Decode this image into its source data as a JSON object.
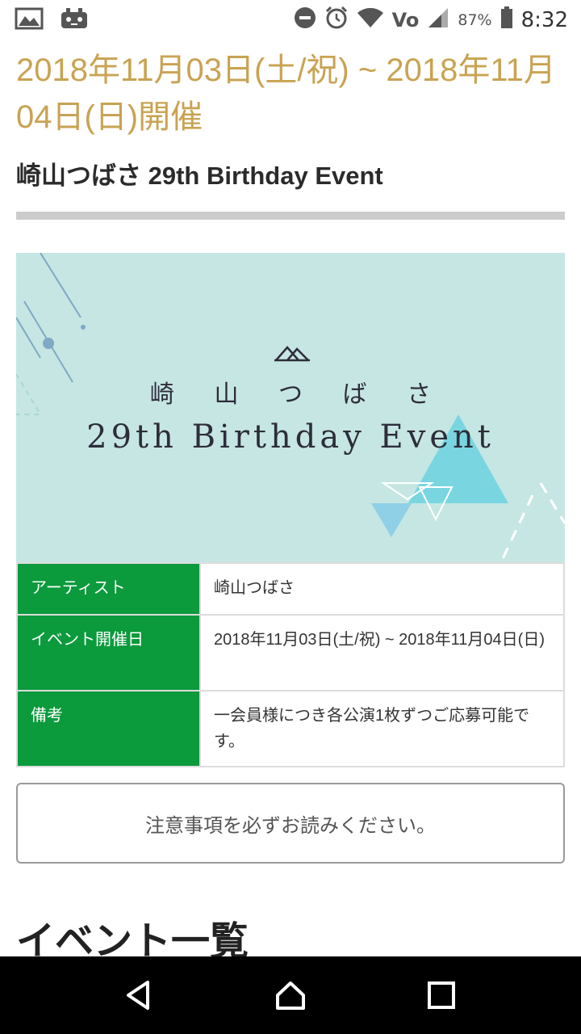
{
  "status_bar": {
    "battery_percent": "87%",
    "time": "8:32",
    "network_label": "Vo",
    "icons": [
      "gallery-icon",
      "game-icon",
      "do-not-disturb-icon",
      "alarm-icon",
      "wifi-icon",
      "volte-icon",
      "signal-icon",
      "battery-icon"
    ]
  },
  "event": {
    "date_heading": "2018年11月03日(土/祝) ~ 2018年11月04日(日)開催",
    "title": "崎山つばさ 29th Birthday Event"
  },
  "banner": {
    "artist_name": "崎 山 つ ば さ",
    "event_name": "29th Birthday Event",
    "background_color": "#c6e6e3",
    "accent_color": "#5fd0e0"
  },
  "info_table": {
    "rows": [
      {
        "key": "アーティスト",
        "value": "崎山つばさ"
      },
      {
        "key": "イベント開催日",
        "value": "2018年11月03日(土/祝) ~ 2018年11月04日(日)"
      },
      {
        "key": "備考",
        "value": "一会員様につき各公演1枚ずつご応募可能です。"
      }
    ],
    "key_color": "#0b9a3c"
  },
  "notice_button": {
    "label": "注意事項を必ずお読みください。"
  },
  "section": {
    "heading": "イベント一覧"
  },
  "nav": {
    "back": "back-icon",
    "home": "home-icon",
    "recents": "recents-icon"
  },
  "colors": {
    "date_gold": "#c9a352",
    "divider_gray": "#cccccc"
  }
}
